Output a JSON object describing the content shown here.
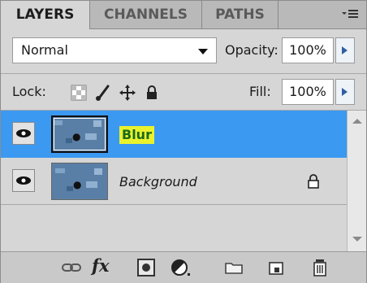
{
  "tabs": [
    {
      "label": "LAYERS",
      "active": true
    },
    {
      "label": "CHANNELS",
      "active": false
    },
    {
      "label": "PATHS",
      "active": false
    }
  ],
  "blend_mode": "Normal",
  "opacity": {
    "label": "Opacity:",
    "value": "100%"
  },
  "lock": {
    "label": "Lock:",
    "icons": [
      "lock-transparent-pixels-icon",
      "lock-image-pixels-icon",
      "lock-position-icon",
      "lock-all-icon"
    ]
  },
  "fill": {
    "label": "Fill:",
    "value": "100%"
  },
  "layers": [
    {
      "name": "Blur",
      "selected": true,
      "visible": true,
      "locked": false
    },
    {
      "name": "Background",
      "selected": false,
      "visible": true,
      "locked": true
    }
  ],
  "footer_icons": [
    "link-layers-icon",
    "fx-icon",
    "add-layer-mask-icon",
    "adjustment-layer-icon",
    "new-group-icon",
    "new-layer-icon",
    "delete-layer-icon"
  ],
  "colors": {
    "selection": "#3b99f2",
    "highlight": "#eaf22d",
    "panel": "#d6d6d6"
  }
}
